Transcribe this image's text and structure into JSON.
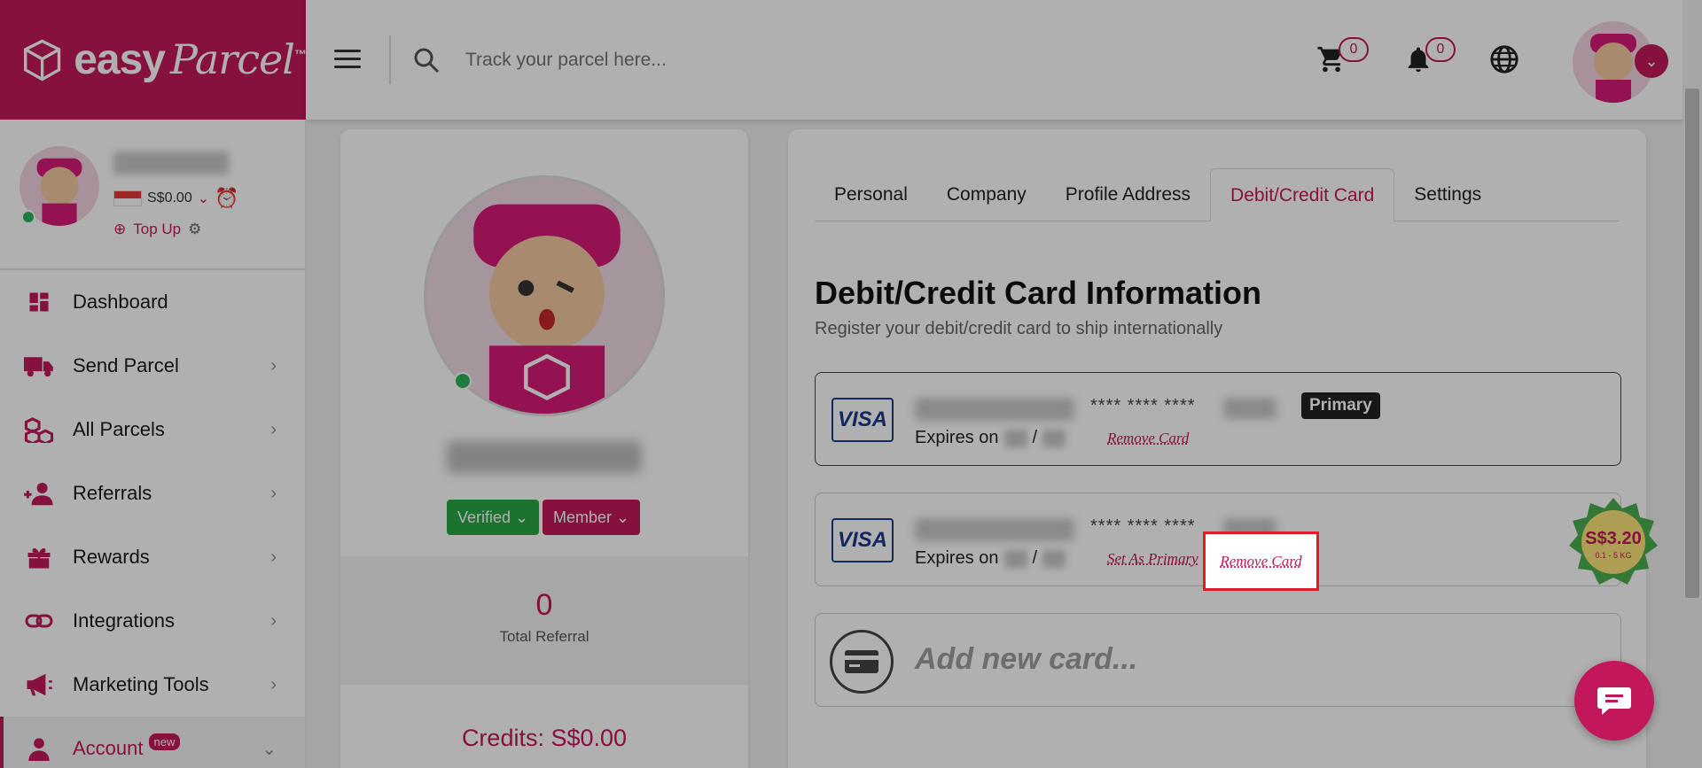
{
  "brand": {
    "name": "easy",
    "script": "Parcel",
    "tm": "™",
    "color": "#c2185b"
  },
  "header": {
    "search_placeholder": "Track your parcel here...",
    "cart_count": "0",
    "notification_count": "0"
  },
  "sidebar": {
    "balance": "S$0.00",
    "topup_label": "Top Up",
    "items": [
      {
        "label": "Dashboard",
        "icon": "dashboard-icon"
      },
      {
        "label": "Send Parcel",
        "icon": "truck-icon"
      },
      {
        "label": "All Parcels",
        "icon": "boxes-icon"
      },
      {
        "label": "Referrals",
        "icon": "users-icon"
      },
      {
        "label": "Rewards",
        "icon": "gift-icon"
      },
      {
        "label": "Integrations",
        "icon": "link-icon"
      },
      {
        "label": "Marketing Tools",
        "icon": "megaphone-icon"
      },
      {
        "label": "Account",
        "icon": "user-icon",
        "badge": "new"
      }
    ]
  },
  "profile": {
    "verified_label": "Verified",
    "member_label": "Member",
    "total_referral": "0",
    "total_referral_label": "Total Referral",
    "credits": "Credits: S$0.00"
  },
  "tabs": [
    "Personal",
    "Company",
    "Profile Address",
    "Debit/Credit Card",
    "Settings"
  ],
  "active_tab": "Debit/Credit Card",
  "section": {
    "title": "Debit/Credit Card Information",
    "subtitle": "Register your debit/credit card to ship internationally"
  },
  "cards": [
    {
      "brand": "VISA",
      "masked": "**** **** ****",
      "expires_label": "Expires on",
      "badge": "Primary",
      "remove_label": "Remove Card"
    },
    {
      "brand": "VISA",
      "masked": "**** **** ****",
      "expires_label": "Expires on",
      "set_primary_label": "Set As Primary",
      "separator": ".",
      "remove_label": "Remove Card"
    }
  ],
  "add_card_label": "Add new card...",
  "promo": {
    "price": "S$3.20",
    "note": "0.1 - 5 KG"
  }
}
